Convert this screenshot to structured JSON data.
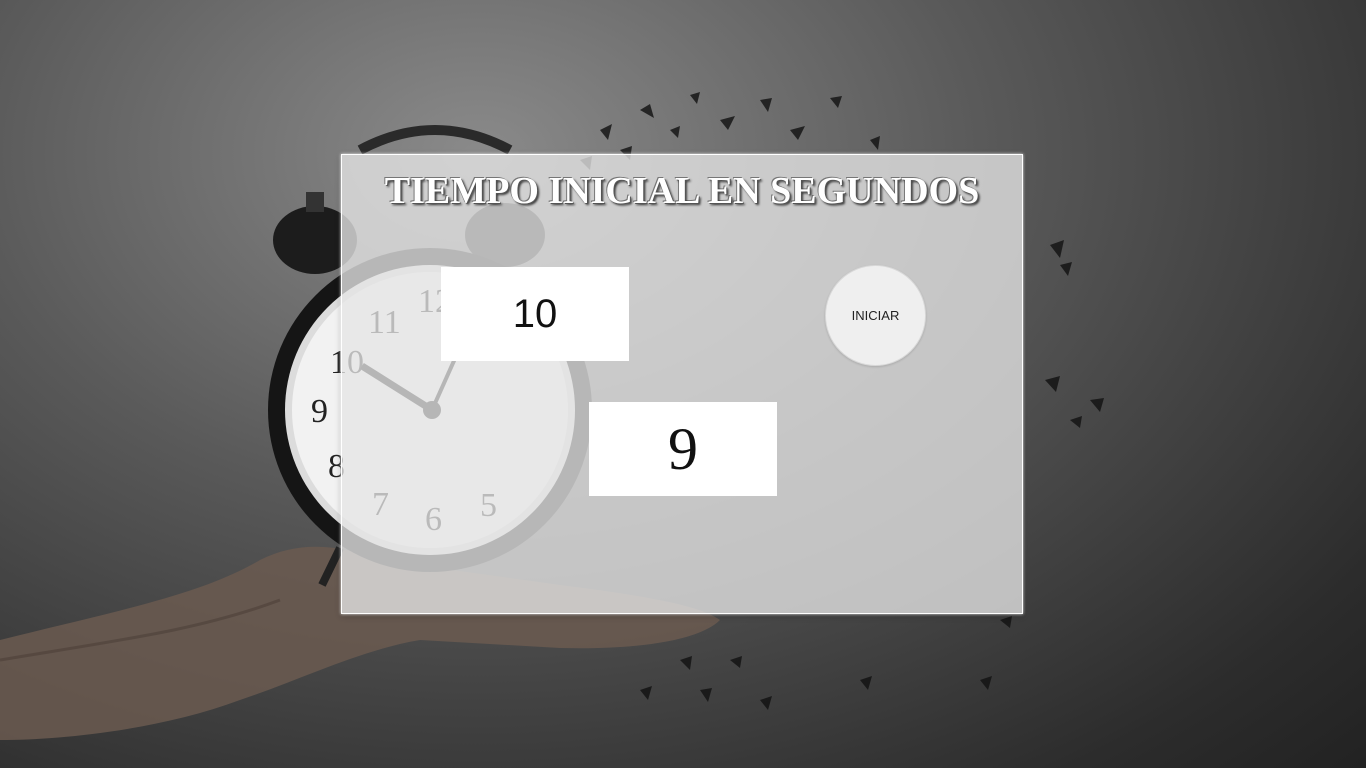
{
  "page": {
    "title": "TIEMPO INICIAL EN SEGUNDOS"
  },
  "timer": {
    "initial_seconds": "10",
    "start_label": "INICIAR",
    "countdown_value": "9"
  },
  "background": {
    "image": "alarm-clock-on-hand-shattering",
    "clock_numerals": [
      "11",
      "12",
      "10",
      "9",
      "8",
      "7",
      "6",
      "5"
    ]
  },
  "colors": {
    "panel_bg": "#e6e6e6",
    "panel_border": "#ffffff",
    "title_text": "#ffffff",
    "button_bg": "#efefef"
  }
}
